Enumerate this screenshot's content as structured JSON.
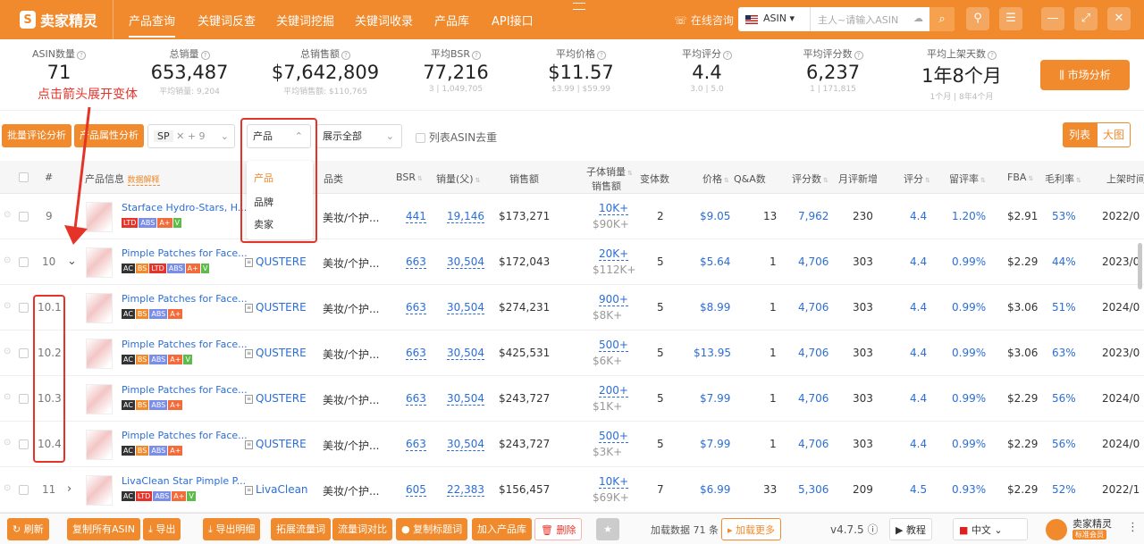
{
  "app": {
    "name": "卖家精灵",
    "version": "v4.7.5"
  },
  "nav": [
    "产品查询",
    "关键词反查",
    "关键词挖掘",
    "关键词收录",
    "产品库",
    "API接口"
  ],
  "consult": "在线咨询",
  "search": {
    "market": "ASIN",
    "placeholder": "主人~请输入ASIN"
  },
  "stats": [
    {
      "label": "ASIN数量",
      "value": "71",
      "sub": ""
    },
    {
      "label": "总销量",
      "value": "653,487",
      "sub": "平均销量: 9,204"
    },
    {
      "label": "总销售额",
      "value": "$7,642,809",
      "sub": "平均销售额: $110,765"
    },
    {
      "label": "平均BSR",
      "value": "77,216",
      "sub": "3 | 1,049,705"
    },
    {
      "label": "平均价格",
      "value": "$11.57",
      "sub": "$3.99 | $59.99"
    },
    {
      "label": "平均评分",
      "value": "4.4",
      "sub": "3.0 | 5.0"
    },
    {
      "label": "平均评分数",
      "value": "6,237",
      "sub": "1 | 171,815"
    },
    {
      "label": "平均上架天数",
      "value": "1年8个月",
      "sub": "1个月 | 8年4个月"
    }
  ],
  "market_btn": "市场分析",
  "annotation": "点击箭头展开变体",
  "toolbar": {
    "batch_review": "批量评论分析",
    "attr": "产品属性分析",
    "tag": "SP",
    "more": "+ 9",
    "group": "产品",
    "show": "展示全部",
    "dedupe": "列表ASIN去重",
    "view_list": "列表",
    "view_big": "大图"
  },
  "dropdown": [
    "产品",
    "品牌",
    "卖家"
  ],
  "headers": {
    "num": "#",
    "info": "产品信息",
    "info_link": "数据解释",
    "category": "品类",
    "bsr": "BSR",
    "sales": "销量(父)",
    "revenue": "销售额",
    "child1": "子体销量",
    "child2": "销售额",
    "variants": "变体数",
    "price": "价格",
    "qa": "Q&A数",
    "ratings": "评分数",
    "monthly": "月评新增",
    "rating": "评分",
    "review_rate": "留评率",
    "fba": "FBA",
    "margin": "毛利率",
    "listed": "上架时间"
  },
  "rows": [
    {
      "num": "9",
      "title": "Starface Hydro-Stars, H...",
      "badges": [
        "LTD",
        "ABS",
        "A+",
        "V"
      ],
      "brand": "",
      "cat": "美妆/个护...",
      "bsr": "441",
      "sales": "19,146",
      "rev": "$173,271",
      "cs": "10K+",
      "cr": "$90K+",
      "var": "2",
      "price": "$9.05",
      "qa": "13",
      "ratings": "7,962",
      "monthly": "230",
      "rating": "4.4",
      "rr": "1.20%",
      "fba": "$2.91",
      "margin": "53%",
      "date": "2022/0"
    },
    {
      "num": "10",
      "title": "Pimple Patches for Face...",
      "badges": [
        "AC",
        "BS",
        "LTD",
        "ABS",
        "A+",
        "V"
      ],
      "brand": "QUSTERE",
      "cat": "美妆/个护...",
      "bsr": "663",
      "sales": "30,504",
      "rev": "$172,043",
      "cs": "20K+",
      "cr": "$112K+",
      "var": "5",
      "price": "$5.64",
      "qa": "1",
      "ratings": "4,706",
      "monthly": "303",
      "rating": "4.4",
      "rr": "0.99%",
      "fba": "$2.29",
      "margin": "44%",
      "date": "2023/0"
    },
    {
      "num": "10.1",
      "title": "Pimple Patches for Face...",
      "badges": [
        "AC",
        "BS",
        "ABS",
        "A+"
      ],
      "brand": "QUSTERE",
      "cat": "美妆/个护...",
      "bsr": "663",
      "sales": "30,504",
      "rev": "$274,231",
      "cs": "900+",
      "cr": "$8K+",
      "var": "5",
      "price": "$8.99",
      "qa": "1",
      "ratings": "4,706",
      "monthly": "303",
      "rating": "4.4",
      "rr": "0.99%",
      "fba": "$3.06",
      "margin": "51%",
      "date": "2024/0"
    },
    {
      "num": "10.2",
      "title": "Pimple Patches for Face...",
      "badges": [
        "AC",
        "BS",
        "ABS",
        "A+",
        "V"
      ],
      "brand": "QUSTERE",
      "cat": "美妆/个护...",
      "bsr": "663",
      "sales": "30,504",
      "rev": "$425,531",
      "cs": "500+",
      "cr": "$6K+",
      "var": "5",
      "price": "$13.95",
      "qa": "1",
      "ratings": "4,706",
      "monthly": "303",
      "rating": "4.4",
      "rr": "0.99%",
      "fba": "$3.06",
      "margin": "63%",
      "date": "2023/0"
    },
    {
      "num": "10.3",
      "title": "Pimple Patches for Face...",
      "badges": [
        "AC",
        "BS",
        "ABS",
        "A+"
      ],
      "brand": "QUSTERE",
      "cat": "美妆/个护...",
      "bsr": "663",
      "sales": "30,504",
      "rev": "$243,727",
      "cs": "200+",
      "cr": "$1K+",
      "var": "5",
      "price": "$7.99",
      "qa": "1",
      "ratings": "4,706",
      "monthly": "303",
      "rating": "4.4",
      "rr": "0.99%",
      "fba": "$2.29",
      "margin": "56%",
      "date": "2024/0"
    },
    {
      "num": "10.4",
      "title": "Pimple Patches for Face...",
      "badges": [
        "AC",
        "BS",
        "ABS",
        "A+"
      ],
      "brand": "QUSTERE",
      "cat": "美妆/个护...",
      "bsr": "663",
      "sales": "30,504",
      "rev": "$243,727",
      "cs": "500+",
      "cr": "$3K+",
      "var": "5",
      "price": "$7.99",
      "qa": "1",
      "ratings": "4,706",
      "monthly": "303",
      "rating": "4.4",
      "rr": "0.99%",
      "fba": "$2.29",
      "margin": "56%",
      "date": "2024/0"
    },
    {
      "num": "11",
      "title": "LivaClean Star Pimple P...",
      "badges": [
        "AC",
        "LTD",
        "ABS",
        "A+",
        "V"
      ],
      "brand": "LivaClean",
      "cat": "美妆/个护...",
      "bsr": "605",
      "sales": "22,383",
      "rev": "$156,457",
      "cs": "10K+",
      "cr": "$69K+",
      "var": "7",
      "price": "$6.99",
      "qa": "33",
      "ratings": "5,306",
      "monthly": "209",
      "rating": "4.5",
      "rr": "0.93%",
      "fba": "$2.29",
      "margin": "52%",
      "date": "2022/1"
    }
  ],
  "bottom": {
    "refresh": "刷新",
    "copy_asin": "复制所有ASIN",
    "export": "导出",
    "export_detail": "导出明细",
    "expand": "拓展流量词",
    "compare": "流量词对比",
    "copy_title": "复制标题词",
    "add_lib": "加入产品库",
    "delete": "删除",
    "loaded": "加载数据 71 条",
    "load_more": "加载更多",
    "tutorial": "教程",
    "lang": "中文",
    "user": "卖家精灵",
    "member": "标准会员"
  },
  "colors": {
    "accent": "#f08a2c",
    "link": "#2c6ed5",
    "annot": "#e6332a"
  }
}
